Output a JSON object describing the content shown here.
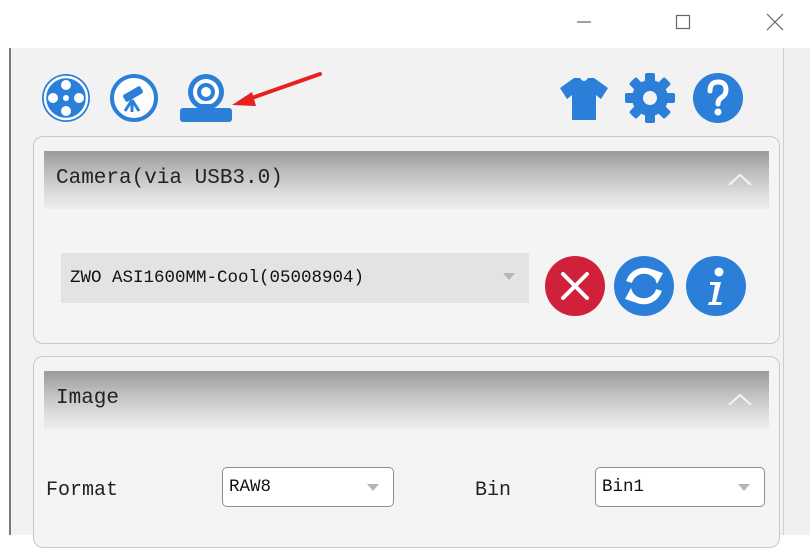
{
  "window": {
    "controls": {
      "minimize": "minimize-icon",
      "maximize": "maximize-icon",
      "close": "close-icon"
    }
  },
  "toolbar": {
    "left_icons": [
      "camera-reel-icon",
      "telescope-icon",
      "webcam-device-icon"
    ],
    "right_icons": [
      "tshirt-icon",
      "gear-icon",
      "help-icon"
    ],
    "icon_color": "#2b7fd8"
  },
  "camera_panel": {
    "title": "Camera(via USB3.0)",
    "selected_camera": "ZWO ASI1600MM-Cool(05008904)",
    "buttons": {
      "disconnect": "close-circle-icon",
      "refresh": "refresh-icon",
      "info": "info-icon"
    },
    "disconnect_color": "#d0203a"
  },
  "image_panel": {
    "title": "Image",
    "format_label": "Format",
    "format_value": "RAW8",
    "bin_label": "Bin",
    "bin_value": "Bin1"
  },
  "annotation": {
    "arrow_color": "#e82020"
  }
}
